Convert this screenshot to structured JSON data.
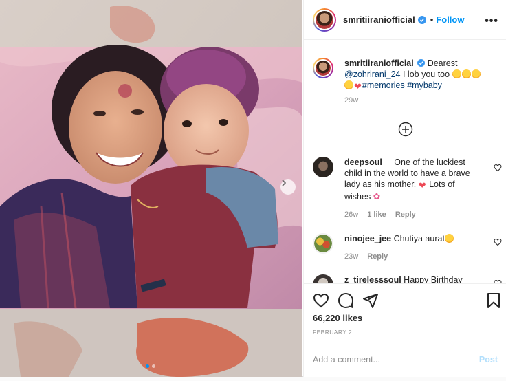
{
  "post": {
    "username": "smritiiraniofficial",
    "follow_label": "Follow",
    "bullet": "•",
    "more_label": "•••"
  },
  "caption": {
    "username": "smritiiraniofficial",
    "text_intro": "Dearest",
    "mention": "@zohrirani_24",
    "text_body": "I lob you too",
    "hashtags": "#memories #mybaby",
    "age": "29w"
  },
  "comments": [
    {
      "username": "deepsoul__",
      "text": "One of the luckiest child in the world to have a brave lady as his mother.",
      "text2": "Lots of wishes",
      "age": "26w",
      "likes": "1 like",
      "reply": "Reply"
    },
    {
      "username": "ninojee_jee",
      "text": "Chutiya aurat",
      "age": "23w",
      "reply": "Reply"
    },
    {
      "username": "z_tirelesssoul",
      "text": "Happy Birthday"
    }
  ],
  "stats": {
    "likes": "66,220 likes",
    "date": "FEBRUARY 2"
  },
  "composer": {
    "placeholder": "Add a comment...",
    "post_label": "Post"
  },
  "icons": [
    "verified-badge",
    "more-options-icon",
    "add-circle-icon",
    "heart-icon",
    "comment-icon",
    "share-icon",
    "bookmark-icon",
    "carousel-next-icon"
  ],
  "colors": {
    "accent": "#0095f6",
    "link": "#00376b",
    "heart": "#ed4956"
  }
}
